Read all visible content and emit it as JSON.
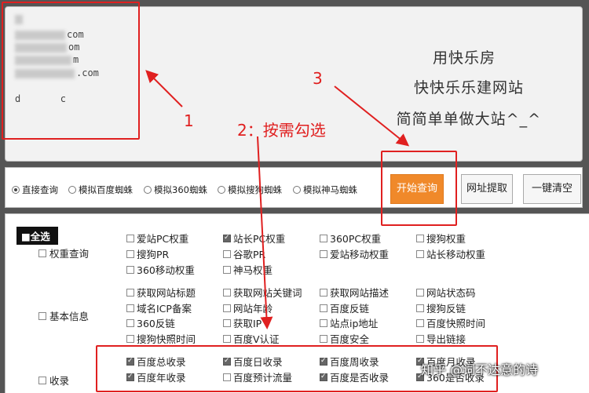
{
  "domain_list": {
    "lines": [
      {
        "suffix": "com"
      },
      {
        "suffix": "om"
      },
      {
        "suffix": "m"
      },
      {
        "suffix": ".com"
      },
      {
        "suffix": "d       c"
      }
    ],
    "hint_lines": [
      "用快乐房",
      "快快乐乐建网站",
      "简简单单做大站^_^"
    ]
  },
  "modes": {
    "options": [
      {
        "label": "直接查询",
        "selected": true
      },
      {
        "label": "模拟百度蜘蛛",
        "selected": false
      },
      {
        "label": "模拟360蜘蛛",
        "selected": false
      },
      {
        "label": "模拟搜狗蜘蛛",
        "selected": false
      },
      {
        "label": "模拟神马蜘蛛",
        "selected": false
      }
    ]
  },
  "buttons": {
    "start": "开始查询",
    "extract": "网址提取",
    "clear": "一键清空"
  },
  "options_panel": {
    "select_all": "■全选",
    "groups": [
      {
        "label": "权重查询",
        "items": [
          {
            "label": "爱站PC权重",
            "checked": false
          },
          {
            "label": "站长PC权重",
            "checked": true
          },
          {
            "label": "360PC权重",
            "checked": false
          },
          {
            "label": "搜狗权重",
            "checked": false
          },
          {
            "label": "搜狗PR",
            "checked": false
          },
          {
            "label": "谷歌PR",
            "checked": false
          },
          {
            "label": "爱站移动权重",
            "checked": false
          },
          {
            "label": "站长移动权重",
            "checked": false
          },
          {
            "label": "360移动权重",
            "checked": false
          },
          {
            "label": "神马权重",
            "checked": false
          }
        ]
      },
      {
        "label": "基本信息",
        "items": [
          {
            "label": "获取网站标题",
            "checked": false
          },
          {
            "label": "获取网站关键词",
            "checked": false
          },
          {
            "label": "获取网站描述",
            "checked": false
          },
          {
            "label": "网站状态码",
            "checked": false
          },
          {
            "label": "域名ICP备案",
            "checked": false
          },
          {
            "label": "网站年龄",
            "checked": false
          },
          {
            "label": "百度反链",
            "checked": false
          },
          {
            "label": "搜狗反链",
            "checked": false
          },
          {
            "label": "360反链",
            "checked": false
          },
          {
            "label": "获取IP",
            "checked": false
          },
          {
            "label": "站点ip地址",
            "checked": false
          },
          {
            "label": "百度快照时间",
            "checked": false
          },
          {
            "label": "搜狗快照时间",
            "checked": false
          },
          {
            "label": "百度V认证",
            "checked": false
          },
          {
            "label": "百度安全",
            "checked": false
          },
          {
            "label": "导出链接",
            "checked": false
          }
        ]
      },
      {
        "label": "收录",
        "items": [
          {
            "label": "百度总收录",
            "checked": true
          },
          {
            "label": "百度日收录",
            "checked": true
          },
          {
            "label": "百度周收录",
            "checked": true
          },
          {
            "label": "百度月收录",
            "checked": true
          },
          {
            "label": "百度年收录",
            "checked": true
          },
          {
            "label": "百度预计流量",
            "checked": false
          },
          {
            "label": "百度是否收录",
            "checked": true
          },
          {
            "label": "360是否收录",
            "checked": true
          }
        ]
      }
    ]
  },
  "annotations": {
    "label_1": "1",
    "label_2": "2：按需勾选",
    "label_3": "3"
  },
  "watermark": "知乎 @词不达意的诗",
  "colors": {
    "accent": "#f0892a",
    "annotation_red": "#e02020"
  }
}
